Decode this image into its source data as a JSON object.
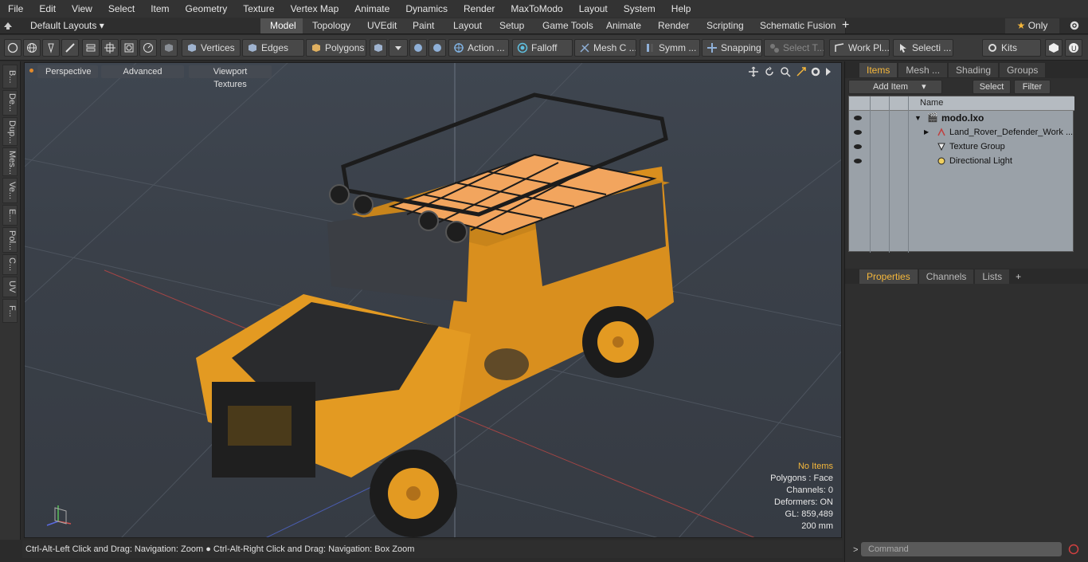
{
  "menu": [
    "File",
    "Edit",
    "View",
    "Select",
    "Item",
    "Geometry",
    "Texture",
    "Vertex Map",
    "Animate",
    "Dynamics",
    "Render",
    "MaxToModo",
    "Layout",
    "System",
    "Help"
  ],
  "layouts_label": "Default Layouts",
  "mode_tabs": [
    "Model",
    "Topology",
    "UVEdit",
    "Paint",
    "Layout",
    "Setup",
    "Game Tools",
    "Animate",
    "Render",
    "Scripting",
    "Schematic Fusion"
  ],
  "active_tab": "Model",
  "only_label": "Only",
  "toolbar": {
    "vertices": "Vertices",
    "edges": "Edges",
    "polygons": "Polygons",
    "action": "Action ...",
    "falloff": "Falloff",
    "mesh": "Mesh C ...",
    "symm": "Symm ...",
    "snapping": "Snapping",
    "select_t": "Select T...",
    "work_pl": "Work Pl...",
    "selecti": "Selecti ...",
    "kits": "Kits"
  },
  "left_tabs": [
    "B...",
    "De...",
    "Dup...",
    "Mes...",
    "Ve...",
    "E...",
    "Pol...",
    "C...",
    "UV",
    "F..."
  ],
  "viewport": {
    "perspective": "Perspective",
    "advanced": "Advanced",
    "textures": "Viewport Textures",
    "stats": {
      "no_items": "No Items",
      "polygons": "Polygons : Face",
      "channels": "Channels: 0",
      "deformers": "Deformers: ON",
      "gl": "GL: 859,489",
      "scale": "200 mm"
    }
  },
  "status_text": "Ctrl-Alt-Left Click and Drag: Navigation: Zoom ● Ctrl-Alt-Right Click and Drag: Navigation: Box Zoom",
  "items_panel": {
    "tabs": [
      "Items",
      "Mesh ...",
      "Shading",
      "Groups"
    ],
    "add_item": "Add Item",
    "select": "Select",
    "filter": "Filter",
    "col_name": "Name",
    "rows": [
      {
        "label": "modo.lxo"
      },
      {
        "label": "Land_Rover_Defender_Work ..."
      },
      {
        "label": "Texture Group"
      },
      {
        "label": "Directional Light"
      }
    ]
  },
  "props_panel": {
    "tabs": [
      "Properties",
      "Channels",
      "Lists"
    ]
  },
  "command_placeholder": "Command",
  "colors": {
    "accent": "#f5b73b",
    "vehicle": "#e39a22"
  }
}
